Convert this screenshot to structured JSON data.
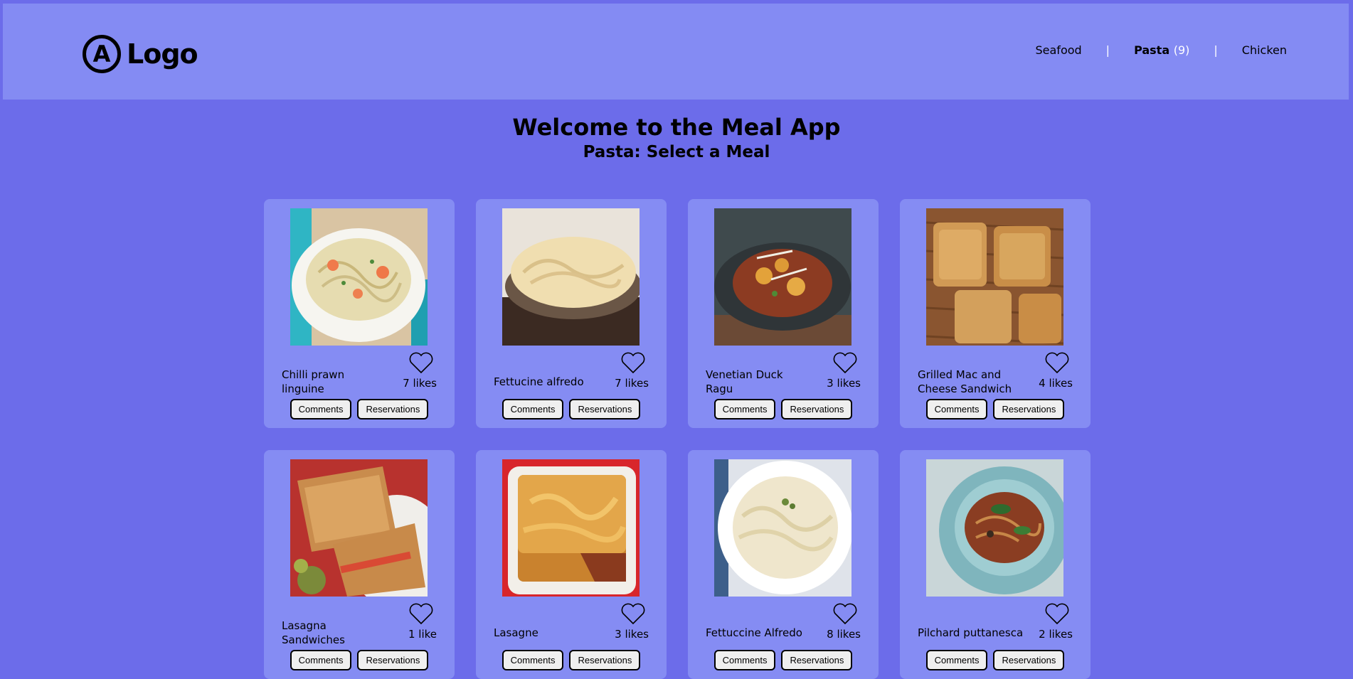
{
  "header": {
    "logo_mark": "A",
    "logo_text": "Logo",
    "nav": [
      {
        "label": "Seafood",
        "count": ""
      },
      {
        "label": "Pasta",
        "count": "(9)"
      },
      {
        "label": "Chicken",
        "count": ""
      }
    ],
    "separator": "|"
  },
  "main": {
    "title": "Welcome to the Meal App",
    "subtitle": "Pasta: Select a Meal"
  },
  "meals": [
    {
      "name": "Chilli prawn linguine",
      "likes": "7 likes",
      "comments_label": "Comments",
      "reservations_label": "Reservations"
    },
    {
      "name": "Fettucine alfredo",
      "likes": "7 likes",
      "comments_label": "Comments",
      "reservations_label": "Reservations"
    },
    {
      "name": "Venetian Duck Ragu",
      "likes": "3 likes",
      "comments_label": "Comments",
      "reservations_label": "Reservations"
    },
    {
      "name": "Grilled Mac and Cheese Sandwich",
      "likes": "4 likes",
      "comments_label": "Comments",
      "reservations_label": "Reservations"
    },
    {
      "name": "Lasagna Sandwiches",
      "likes": "1 like",
      "comments_label": "Comments",
      "reservations_label": "Reservations"
    },
    {
      "name": "Lasagne",
      "likes": "3 likes",
      "comments_label": "Comments",
      "reservations_label": "Reservations"
    },
    {
      "name": "Fettuccine Alfredo",
      "likes": "8 likes",
      "comments_label": "Comments",
      "reservations_label": "Reservations"
    },
    {
      "name": "Pilchard puttanesca",
      "likes": "2 likes",
      "comments_label": "Comments",
      "reservations_label": "Reservations"
    }
  ],
  "colors": {
    "page_bg": "#6c6cea",
    "header_bg": "#848bf3",
    "card_bg": "#858cf3",
    "nav_separator": "#ffffff"
  },
  "icons": {
    "like": "heart-icon"
  }
}
